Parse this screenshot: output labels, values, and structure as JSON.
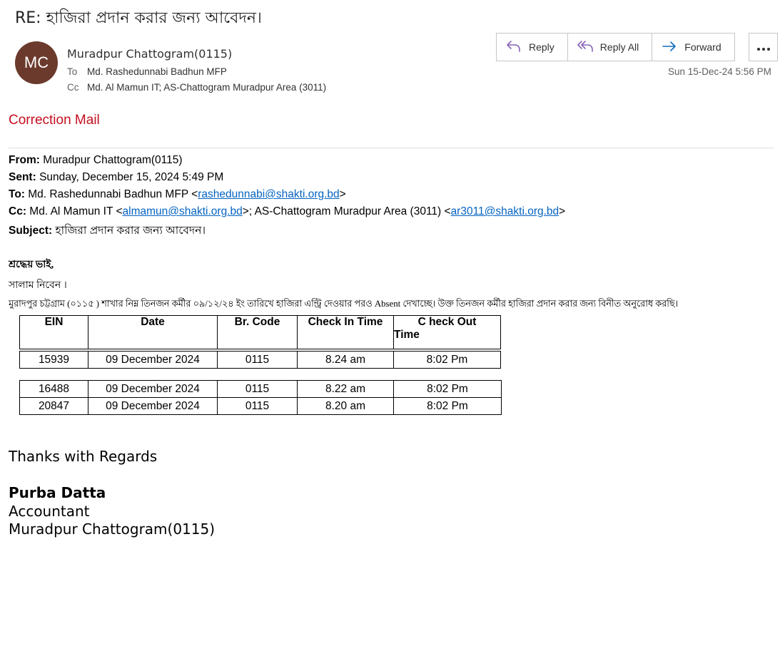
{
  "message": {
    "subject": "RE: হাজিরা প্রদান করার জন্য আবেদন।",
    "avatar_initials": "MC",
    "sender": "Muradpur Chattogram(0115)",
    "to_label": "To",
    "to": "Md. Rashedunnabi Badhun MFP",
    "cc_label": "Cc",
    "cc": "Md. Al Mamun IT; AS-Chattogram Muradpur Area (3011)",
    "timestamp": "Sun 15-Dec-24 5:56 PM"
  },
  "actions": {
    "reply": "Reply",
    "reply_all": "Reply All",
    "forward": "Forward",
    "more_icon": "more-horizontal-icon"
  },
  "colors": {
    "avatar_bg": "#6b3a2c",
    "correction": "#c50f1f",
    "link": "#0563c1",
    "action_icon_purple": "#8764b8",
    "action_icon_blue": "#0f6cbd"
  },
  "body": {
    "correction_label": "Correction Mail",
    "quoted": {
      "from_label": "From:",
      "from": "Muradpur Chattogram(0115)",
      "sent_label": "Sent:",
      "sent": "Sunday, December 15, 2024 5:49 PM",
      "to_label": "To:",
      "to_name": "Md. Rashedunnabi Badhun MFP <",
      "to_email": "rashedunnabi@shakti.org.bd",
      "to_close": ">",
      "cc_label": "Cc:",
      "cc_name1": "Md. Al Mamun IT <",
      "cc_email1": "almamun@shakti.org.bd",
      "cc_mid": ">; AS-Chattogram Muradpur Area (3011) <",
      "cc_email2": "ar3011@shakti.org.bd",
      "cc_close": ">",
      "subject_label": "Subject:",
      "subject": "হাজিরা প্রদান করার জন্য আবেদন।"
    },
    "greeting": "শ্রদ্ধেয় ভাই,",
    "salutation": "সালাম নিবেন ।",
    "paragraph": "মুরাদপুর চট্টগ্রাম (০১১৫ ) শাখার নিম্ন তিনজন কর্মীর ০৯/১২/২৪ ইং তারিখে হাজিরা এন্ট্রি দেওয়ার পরও Absent দেখাচ্ছে। উক্ত তিনজন কর্মীর হাজিরা প্রদান করার জন্য বিনীত অনুরোধ করছি।",
    "table": {
      "headers": [
        "EIN",
        "Date",
        "Br. Code",
        "Check In Time",
        "C heck Out",
        "Time"
      ],
      "rows": [
        [
          "15939",
          "09 December 2024",
          "0115",
          "8.24 am",
          "8:02 Pm"
        ],
        [
          "16488",
          "09 December 2024",
          "0115",
          "8.22 am",
          "8:02 Pm"
        ],
        [
          "20847",
          "09 December 2024",
          "0115",
          "8.20 am",
          "8:02 Pm"
        ]
      ]
    },
    "thanks": "Thanks with Regards",
    "signature_name": "Purba Datta",
    "signature_title": "Accountant",
    "signature_branch": "Muradpur Chattogram(0115)"
  }
}
